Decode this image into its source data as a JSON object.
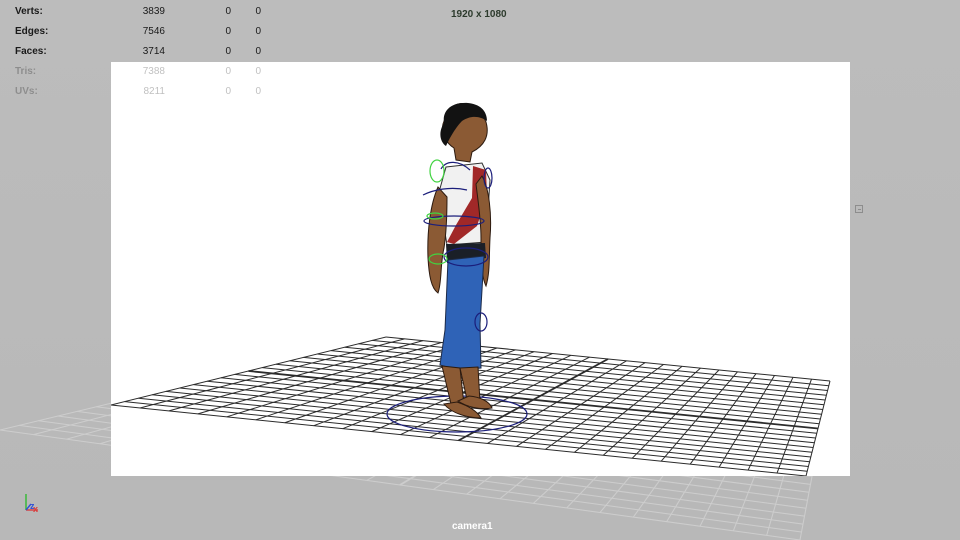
{
  "hud": {
    "stats": [
      {
        "label": "Verts:",
        "values": [
          "3839",
          "0",
          "0"
        ],
        "faint": false
      },
      {
        "label": "Edges:",
        "values": [
          "7546",
          "0",
          "0"
        ],
        "faint": false
      },
      {
        "label": "Faces:",
        "values": [
          "3714",
          "0",
          "0"
        ],
        "faint": false
      },
      {
        "label": "Tris:",
        "values": [
          "7388",
          "0",
          "0"
        ],
        "faint": true
      },
      {
        "label": "UVs:",
        "values": [
          "8211",
          "0",
          "0"
        ],
        "faint": true
      }
    ],
    "resolution": "1920 x 1080",
    "camera": "camera1"
  },
  "colors": {
    "viewport_bg": "#bdbdbd",
    "render_bg": "#ffffff",
    "grid_line": "#2b2b2b",
    "skin": "#8b5a34",
    "shirt": "#f1f1f1",
    "sash": "#a12828",
    "pants": "#2f63b7",
    "belt": "#1a1f27",
    "rig_blue": "#1b1e7b",
    "rig_green": "#41d341"
  },
  "icons": {
    "axis": "axis-gizmo-icon",
    "side_marker": "viewport-marker-icon"
  }
}
